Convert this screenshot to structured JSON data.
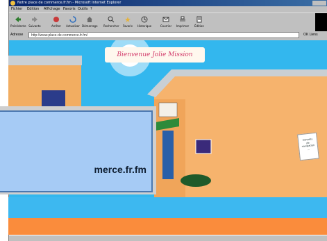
{
  "window": {
    "title": "Notre place de commerce.fr.fm - Microsoft Internet Explorer",
    "menu": [
      "Fichier",
      "Edition",
      "Affichage",
      "Favoris",
      "Outils",
      "?"
    ]
  },
  "toolbar": {
    "buttons": [
      {
        "label": "Précédente",
        "icon": "back-arrow-icon"
      },
      {
        "label": "Suivante",
        "icon": "forward-arrow-icon"
      },
      {
        "label": "Arrêter",
        "icon": "stop-icon"
      },
      {
        "label": "Actualiser",
        "icon": "refresh-icon"
      },
      {
        "label": "Démarrage",
        "icon": "home-icon"
      },
      {
        "label": "Rechercher",
        "icon": "search-icon"
      },
      {
        "label": "Favoris",
        "icon": "favorites-icon"
      },
      {
        "label": "Historique",
        "icon": "history-icon"
      },
      {
        "label": "Courrier",
        "icon": "mail-icon"
      },
      {
        "label": "Imprimer",
        "icon": "print-icon"
      },
      {
        "label": "Édition",
        "icon": "edit-icon"
      }
    ]
  },
  "address": {
    "label": "Adresse",
    "value": "http://www.place-de-commerce.fr.fm/",
    "go_label": "OK  Liens"
  },
  "page": {
    "sign_text": "Bienvenue Jolie Mission",
    "notice_text": "Conseils\nde\nnavigation\n..."
  },
  "dialog": {
    "url_text": "merce.fr.fm"
  },
  "colors": {
    "sky": "#33b7ee",
    "building": "#f6b36d",
    "roof": "#cfd3d6",
    "ground": "#fa8c3c",
    "dialog_bg": "#a6cbf5",
    "dialog_border": "#4a78b0"
  }
}
